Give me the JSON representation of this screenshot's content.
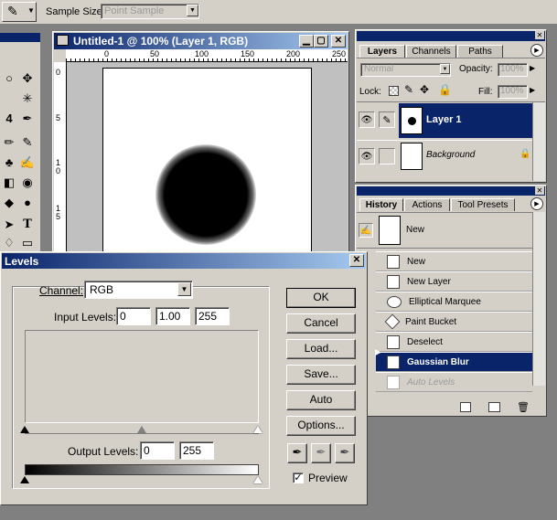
{
  "options_bar": {
    "sample_size_label": "Sample Size:",
    "sample_size_value": "Point Sample"
  },
  "document": {
    "title": "Untitled-1 @ 100% (Layer 1, RGB)",
    "ruler_h": [
      "0",
      "50",
      "100",
      "150",
      "200",
      "250"
    ],
    "ruler_v": [
      "0",
      "5",
      "1 0",
      "1 5"
    ]
  },
  "layers_panel": {
    "tabs": [
      "Layers",
      "Channels",
      "Paths"
    ],
    "blend_mode": "Normal",
    "opacity_label": "Opacity:",
    "opacity_value": "100%",
    "lock_label": "Lock:",
    "fill_label": "Fill:",
    "fill_value": "100%",
    "layers": [
      {
        "name": "Layer 1",
        "selected": true
      },
      {
        "name": "Background",
        "selected": false
      }
    ]
  },
  "history_panel": {
    "tabs": [
      "History",
      "Actions",
      "Tool Presets"
    ],
    "snapshot": "New",
    "states": [
      {
        "label": "New"
      },
      {
        "label": "New Layer"
      },
      {
        "label": "Elliptical Marquee"
      },
      {
        "label": "Paint Bucket"
      },
      {
        "label": "Deselect"
      },
      {
        "label": "Gaussian Blur"
      },
      {
        "label": "Auto Levels"
      }
    ]
  },
  "levels_dialog": {
    "title": "Levels",
    "channel_label": "Channel:",
    "channel_value": "RGB",
    "input_levels_label": "Input Levels:",
    "input_black": "0",
    "input_gamma": "1.00",
    "input_white": "255",
    "output_levels_label": "Output Levels:",
    "output_black": "0",
    "output_white": "255",
    "buttons": {
      "ok": "OK",
      "cancel": "Cancel",
      "load": "Load...",
      "save": "Save...",
      "auto": "Auto",
      "options": "Options..."
    },
    "preview_label": "Preview",
    "preview_checked": true,
    "close_glyph": "✕"
  }
}
